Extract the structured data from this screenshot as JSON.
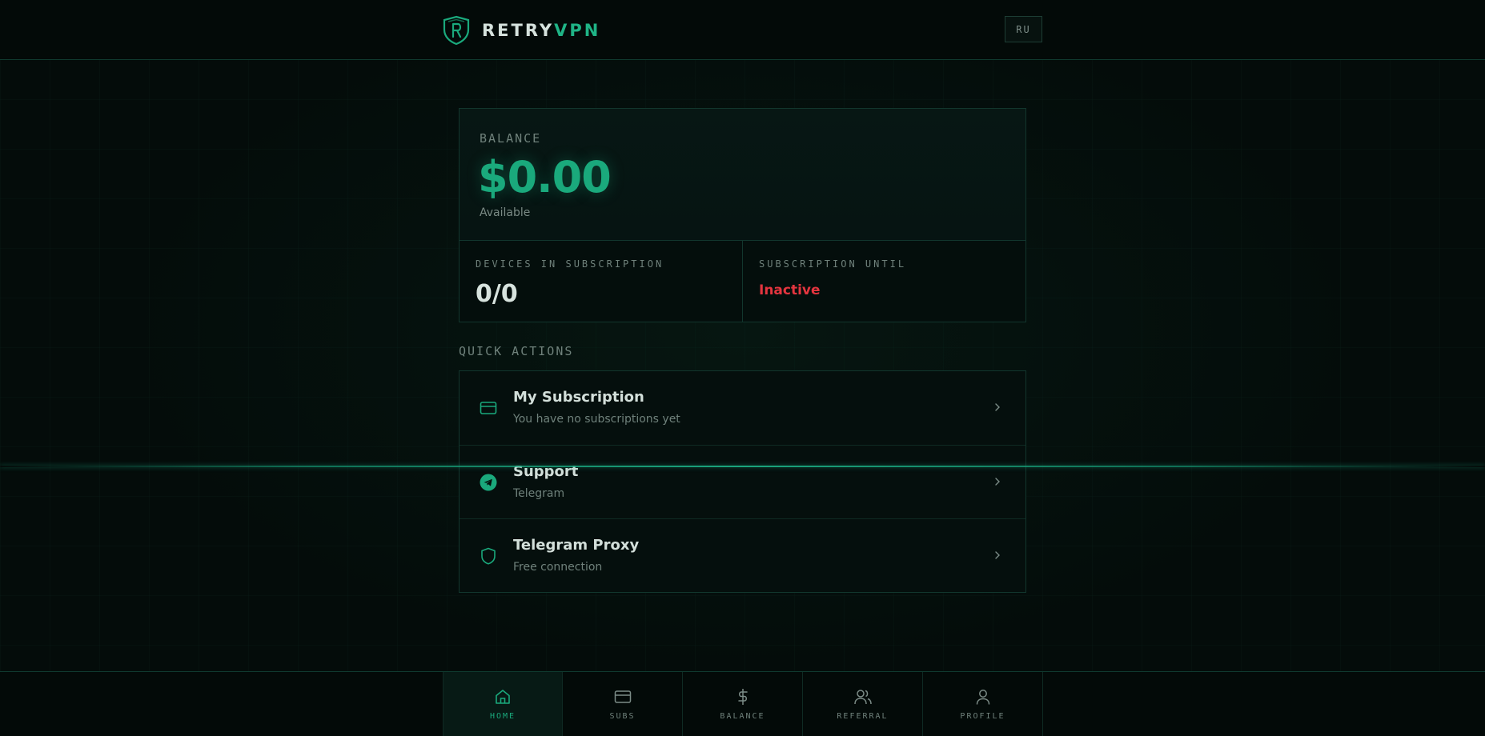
{
  "app": {
    "brand_part1": "RETRY",
    "brand_part2": "VPN",
    "language_button": "RU",
    "accent_color": "#1aa97c",
    "danger_color": "#e4353f"
  },
  "balance": {
    "label": "BALANCE",
    "amount": "$0.00",
    "sub": "Available"
  },
  "stats": {
    "devices_label": "DEVICES IN SUBSCRIPTION",
    "devices_value": "0/0",
    "until_label": "SUBSCRIPTION UNTIL",
    "until_value": "Inactive"
  },
  "quick_actions": {
    "title": "QUICK ACTIONS",
    "items": [
      {
        "title": "My Subscription",
        "subtitle": "You have no subscriptions yet",
        "icon": "credit-card-icon"
      },
      {
        "title": "Support",
        "subtitle": "Telegram",
        "icon": "telegram-icon"
      },
      {
        "title": "Telegram Proxy",
        "subtitle": "Free connection",
        "icon": "shield-icon"
      }
    ]
  },
  "nav": {
    "items": [
      {
        "label": "HOME",
        "icon": "home-icon",
        "active": true
      },
      {
        "label": "SUBS",
        "icon": "credit-card-icon",
        "active": false
      },
      {
        "label": "BALANCE",
        "icon": "dollar-icon",
        "active": false
      },
      {
        "label": "REFERRAL",
        "icon": "users-icon",
        "active": false
      },
      {
        "label": "PROFILE",
        "icon": "user-icon",
        "active": false
      }
    ]
  }
}
